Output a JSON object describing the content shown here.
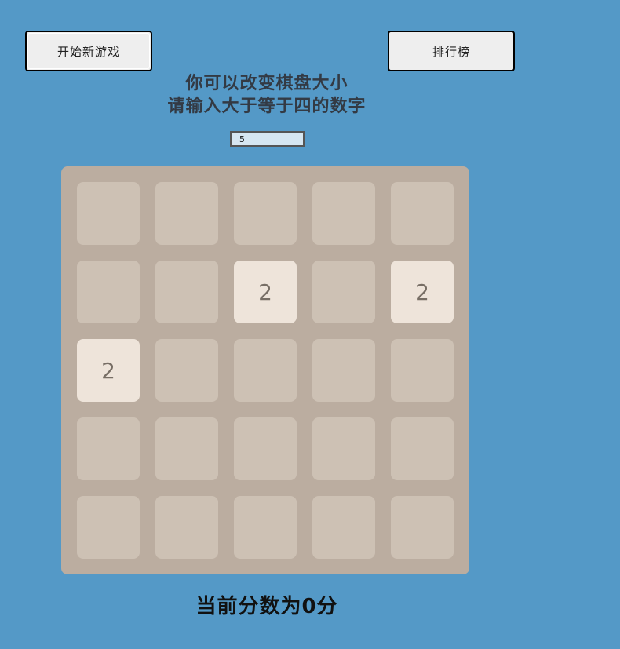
{
  "buttons": {
    "new_game": "开始新游戏",
    "leaderboard": "排行榜"
  },
  "hint": {
    "line1": "你可以改变棋盘大小",
    "line2": "请输入大于等于四的数字"
  },
  "board_size": {
    "value": "5"
  },
  "board": {
    "size": 5,
    "cells": [
      [
        "",
        "",
        "",
        "",
        ""
      ],
      [
        "",
        "",
        "2",
        "",
        "2"
      ],
      [
        "2",
        "",
        "",
        "",
        ""
      ],
      [
        "",
        "",
        "",
        "",
        ""
      ],
      [
        "",
        "",
        "",
        "",
        ""
      ]
    ]
  },
  "score": {
    "text": "当前分数为0分"
  },
  "colors": {
    "background": "#5499c7",
    "board": "#bbada0",
    "empty_cell": "#cdc1b4",
    "tile_2": "#eee4da",
    "tile_text": "#776e65"
  }
}
